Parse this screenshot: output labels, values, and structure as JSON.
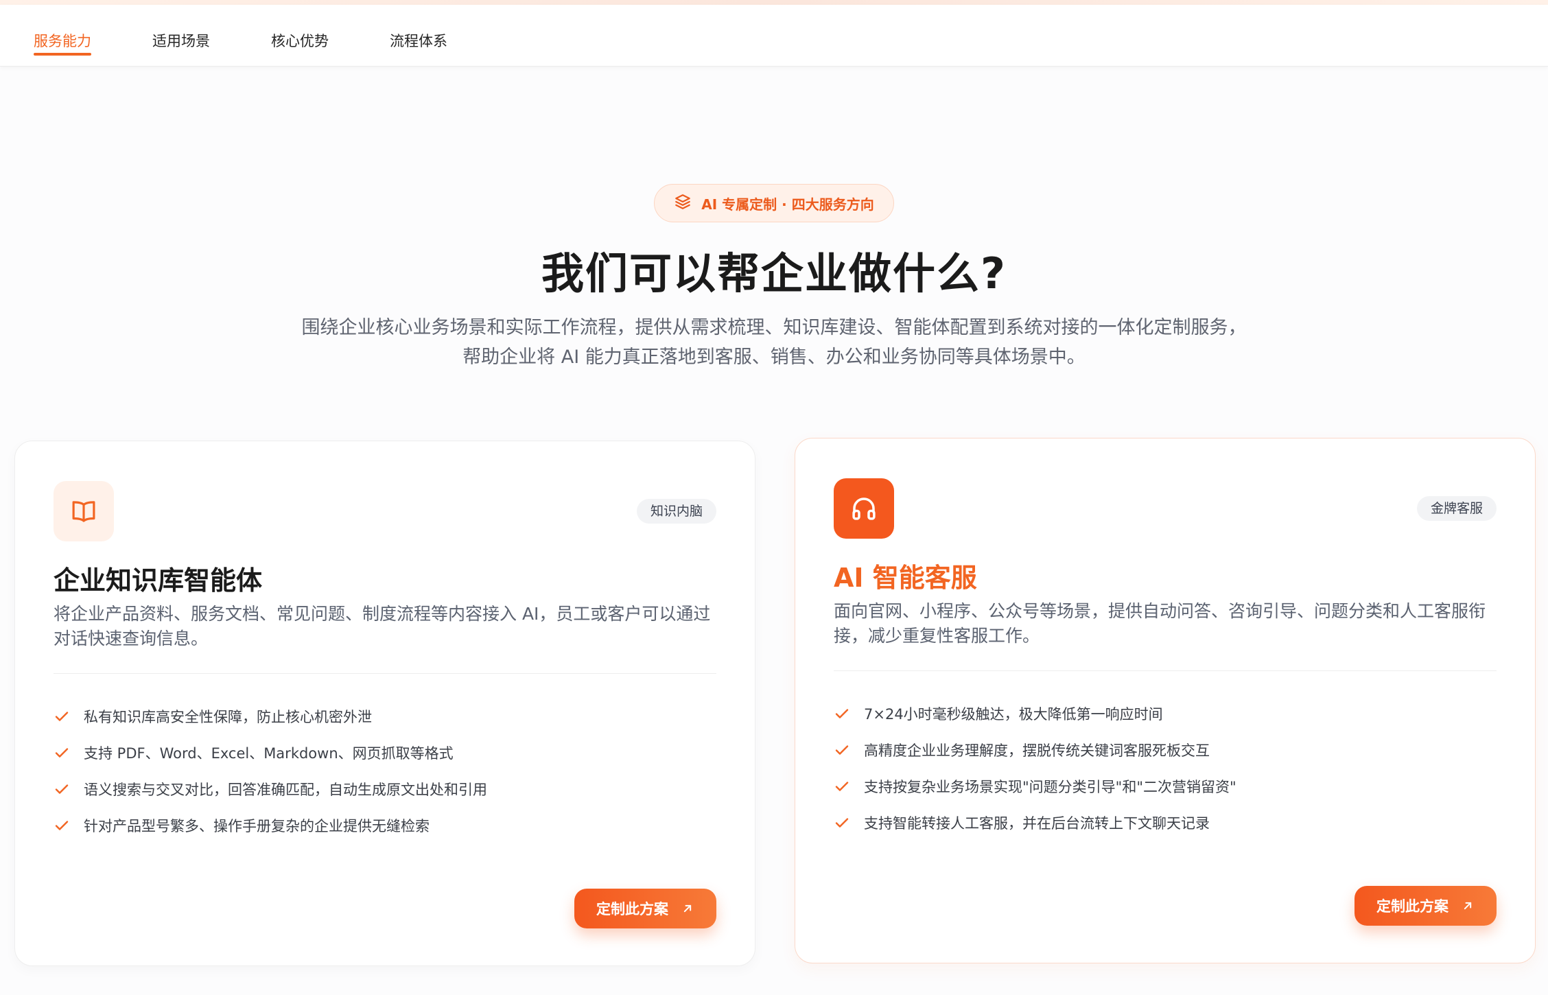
{
  "nav": {
    "tabs": [
      {
        "label": "服务能力",
        "active": true
      },
      {
        "label": "适用场景",
        "active": false
      },
      {
        "label": "核心优势",
        "active": false
      },
      {
        "label": "流程体系",
        "active": false
      }
    ]
  },
  "hero": {
    "badge": "AI 专属定制 · 四大服务方向",
    "badge_icon": "layers-icon",
    "title": "我们可以帮企业做什么?",
    "subtitle": "围绕企业核心业务场景和实际工作流程，提供从需求梳理、知识库建设、智能体配置到系统对接的一体化定制服务，帮助企业将 AI 能力真正落地到客服、销售、办公和业务协同等具体场景中。"
  },
  "cards": [
    {
      "icon": "book-icon",
      "tag": "知识内脑",
      "title": "企业知识库智能体",
      "desc": "将企业产品资料、服务文档、常见问题、制度流程等内容接入 AI，员工或客户可以通过对话快速查询信息。",
      "features": [
        "私有知识库高安全性保障，防止核心机密外泄",
        "支持 PDF、Word、Excel、Markdown、网页抓取等格式",
        "语义搜索与交叉对比，回答准确匹配，自动生成原文出处和引用",
        "针对产品型号繁多、操作手册复杂的企业提供无缝检索"
      ],
      "cta": "定制此方案"
    },
    {
      "icon": "headphones-icon",
      "tag": "金牌客服",
      "title": "AI 智能客服",
      "desc": "面向官网、小程序、公众号等场景，提供自动问答、咨询引导、问题分类和人工客服衔接，减少重复性客服工作。",
      "features": [
        "7×24小时毫秒级触达，极大降低第一响应时间",
        "高精度企业业务理解度，摆脱传统关键词客服死板交互",
        "支持按复杂业务场景实现\"问题分类引导\"和\"二次营销留资\"",
        "支持智能转接人工客服，并在后台流转上下文聊天记录"
      ],
      "cta": "定制此方案"
    }
  ],
  "colors": {
    "accent": "#f26522",
    "accent_light": "#fff1e9",
    "text_dark": "#1b1b1b",
    "text_muted": "#5b6270"
  }
}
